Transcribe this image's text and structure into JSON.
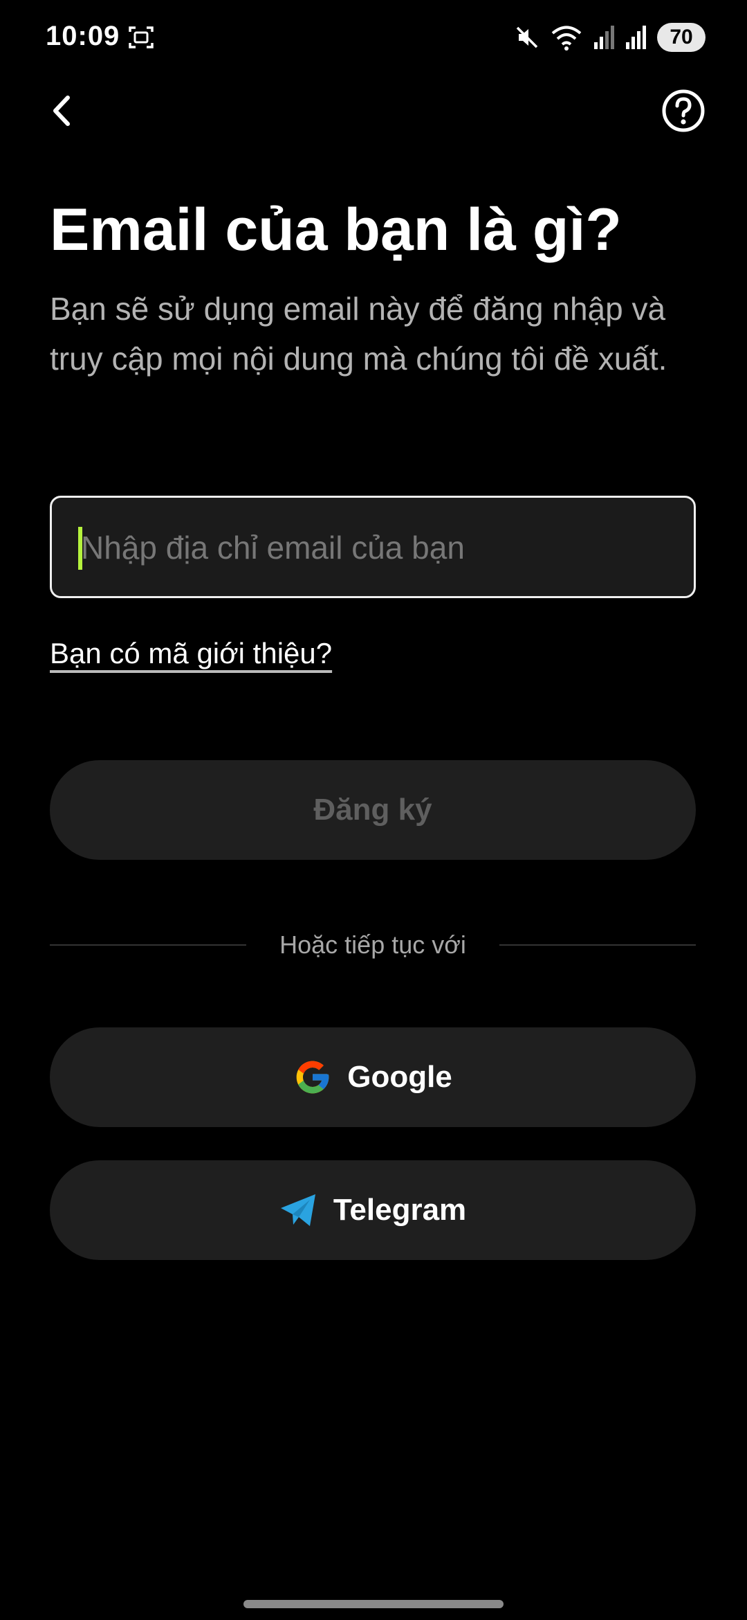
{
  "status_bar": {
    "time": "10:09",
    "battery": "70",
    "icons": [
      "screen-record-icon",
      "mute-icon",
      "wifi-icon",
      "signal-icon",
      "signal-icon",
      "battery-icon"
    ]
  },
  "nav": {
    "back_icon": "chevron-left-icon",
    "help_icon": "question-circle-icon"
  },
  "header": {
    "title": "Email của bạn là gì?",
    "subtitle": "Bạn sẽ sử dụng email này để đăng nhập và truy cập mọi nội dung mà chúng tôi đề xuất."
  },
  "form": {
    "email_value": "",
    "email_placeholder": "Nhập địa chỉ email của bạn",
    "referral_link": "Bạn có mã giới thiệu?",
    "register_label": "Đăng ký"
  },
  "social": {
    "divider_text": "Hoặc tiếp tục với",
    "google_label": "Google",
    "telegram_label": "Telegram"
  },
  "colors": {
    "background": "#000000",
    "button_bg": "#1f1f1f",
    "caret": "#b5f23d",
    "telegram_blue": "#2aa3e0"
  }
}
